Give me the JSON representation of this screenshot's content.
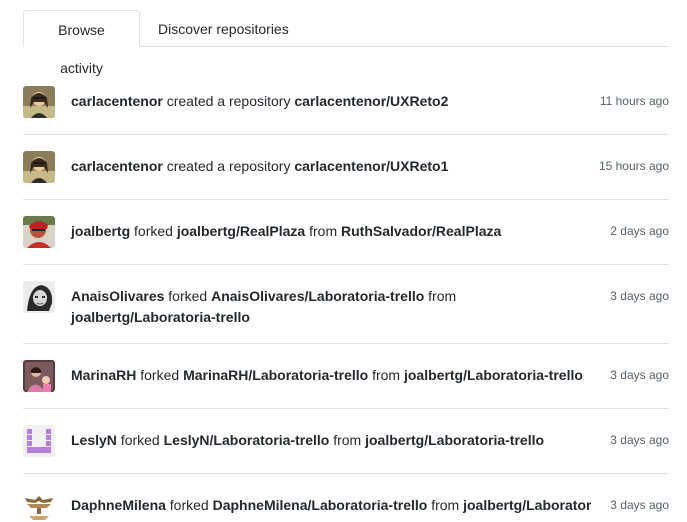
{
  "tabs": [
    {
      "label": "Browse activity",
      "selected": true
    },
    {
      "label": "Discover repositories",
      "selected": false
    }
  ],
  "feed": [
    {
      "user": "carlacentenor",
      "action1": "created a repository",
      "target1": "carlacentenor/UXReto2",
      "action2": "",
      "target2": "",
      "time": "11 hours ago",
      "avatar": "carla-avatar"
    },
    {
      "user": "carlacentenor",
      "action1": "created a repository",
      "target1": "carlacentenor/UXReto1",
      "action2": "",
      "target2": "",
      "time": "15 hours ago",
      "avatar": "carla-avatar"
    },
    {
      "user": "joalbertg",
      "action1": "forked",
      "target1": "joalbertg/RealPlaza",
      "action2": "from",
      "target2": "RuthSalvador/RealPlaza",
      "time": "2 days ago",
      "avatar": "joalbertg-avatar"
    },
    {
      "user": "AnaisOlivares",
      "action1": "forked",
      "target1": "AnaisOlivares/Laboratoria-trello",
      "action2": "from",
      "target2": "joalbertg/Laboratoria-trello",
      "time": "3 days ago",
      "avatar": "anais-avatar"
    },
    {
      "user": "MarinaRH",
      "action1": "forked",
      "target1": "MarinaRH/Laboratoria-trello",
      "action2": "from",
      "target2": "joalbertg/Laboratoria-trello",
      "time": "3 days ago",
      "avatar": "marina-avatar"
    },
    {
      "user": "LeslyN",
      "action1": "forked",
      "target1": "LeslyN/Laboratoria-trello",
      "action2": "from",
      "target2": "joalbertg/Laboratoria-trello",
      "time": "3 days ago",
      "avatar": "lesly-identicon"
    },
    {
      "user": "DaphneMilena",
      "action1": "forked",
      "target1": "DaphneMilena/Laboratoria-trello",
      "action2": "from",
      "target2": "joalbertg/Laboratori",
      "time": "3 days ago",
      "avatar": "daphne-avatar"
    }
  ],
  "colors": {
    "text": "#24292e",
    "muted": "#586069",
    "border": "#e1e4e8",
    "identicon": "#b77fdb"
  }
}
